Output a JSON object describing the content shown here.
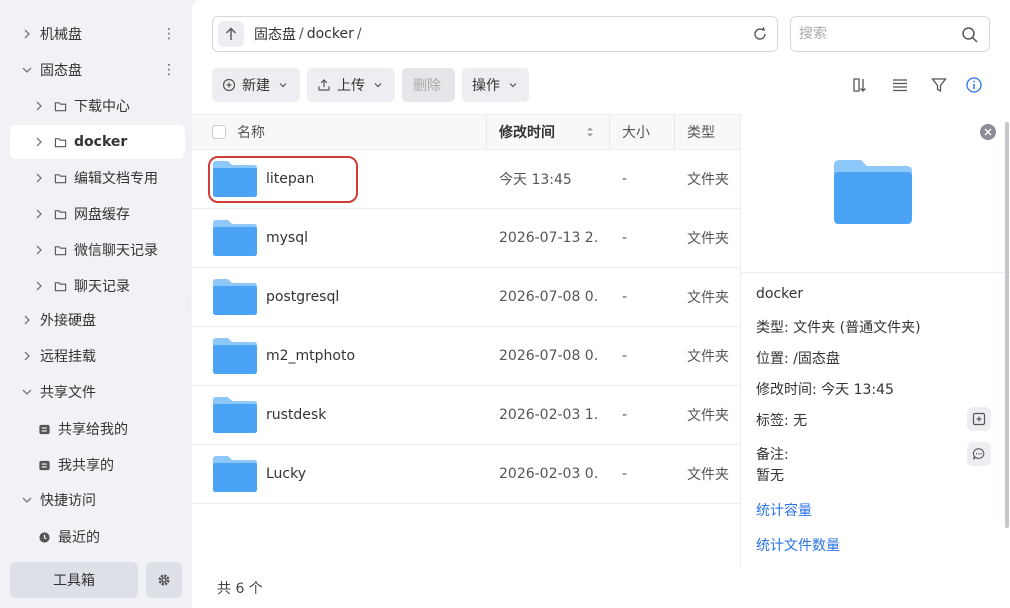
{
  "sidebar": {
    "items": [
      {
        "label": "机械盘"
      },
      {
        "label": "固态盘"
      },
      {
        "label": "下载中心"
      },
      {
        "label": "docker"
      },
      {
        "label": "编辑文档专用"
      },
      {
        "label": "网盘缓存"
      },
      {
        "label": "微信聊天记录"
      },
      {
        "label": "聊天记录"
      },
      {
        "label": "外接硬盘"
      },
      {
        "label": "远程挂载"
      },
      {
        "label": "共享文件"
      },
      {
        "label": "共享给我的"
      },
      {
        "label": "我共享的"
      },
      {
        "label": "快捷访问"
      },
      {
        "label": "最近的"
      }
    ],
    "toolbox_label": "工具箱"
  },
  "path": {
    "crumbs": [
      "固态盘",
      "docker"
    ],
    "separator": "/"
  },
  "search": {
    "placeholder": "搜索"
  },
  "toolbar": {
    "new_label": "新建",
    "upload_label": "上传",
    "delete_label": "删除",
    "action_label": "操作"
  },
  "table": {
    "headers": {
      "name": "名称",
      "mtime": "修改时间",
      "size": "大小",
      "type": "类型"
    },
    "rows": [
      {
        "name": "litepan",
        "mtime": "今天 13:45",
        "size": "-",
        "type": "文件夹"
      },
      {
        "name": "mysql",
        "mtime": "2026-07-13 2…",
        "size": "-",
        "type": "文件夹"
      },
      {
        "name": "postgresql",
        "mtime": "2026-07-08 0…",
        "size": "-",
        "type": "文件夹"
      },
      {
        "name": "m2_mtphoto",
        "mtime": "2026-07-08 0…",
        "size": "-",
        "type": "文件夹"
      },
      {
        "name": "rustdesk",
        "mtime": "2026-02-03 1…",
        "size": "-",
        "type": "文件夹"
      },
      {
        "name": "Lucky",
        "mtime": "2026-02-03 0…",
        "size": "-",
        "type": "文件夹"
      }
    ]
  },
  "footer": {
    "count": "共 6 个"
  },
  "details": {
    "name": "docker",
    "type_label": "类型:",
    "type_value": "文件夹 (普通文件夹)",
    "location_label": "位置:",
    "location_value": "/固态盘",
    "mtime_label": "修改时间:",
    "mtime_value": "今天 13:45",
    "tags_label": "标签:",
    "tags_value": "无",
    "notes_label": "备注:",
    "notes_value": "暂无",
    "link_capacity": "统计容量",
    "link_count": "统计文件数量"
  },
  "colors": {
    "accent": "#2a74e6",
    "highlight": "#d33a3a",
    "folder": "#4aa3f5"
  }
}
